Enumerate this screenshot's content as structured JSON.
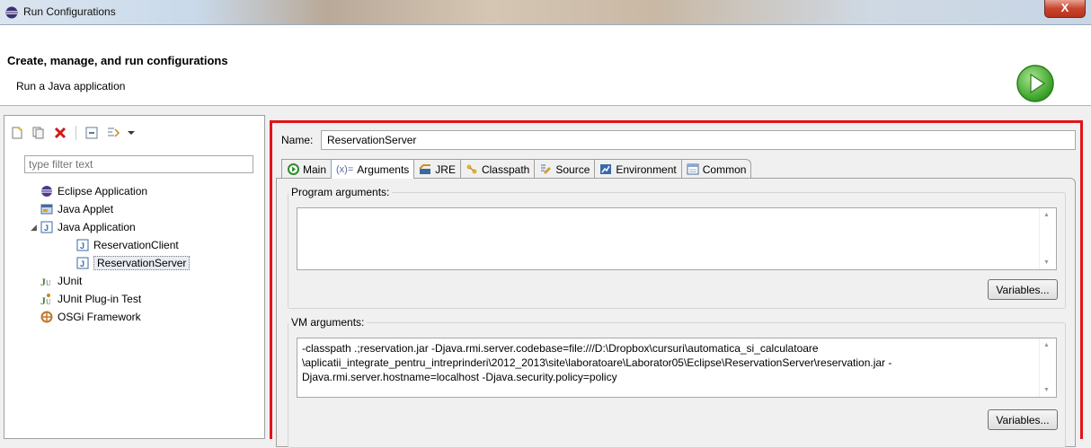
{
  "window": {
    "title": "Run Configurations",
    "close_glyph": "X"
  },
  "banner": {
    "heading": "Create, manage, and run configurations",
    "subheading": "Run a Java application",
    "icon": "run-icon"
  },
  "left": {
    "toolbar_icons": [
      "new-configuration-icon",
      "duplicate-icon",
      "delete-icon",
      "collapse-all-icon",
      "filter-icon",
      "dropdown-arrow-icon"
    ],
    "filter_placeholder": "type filter text",
    "tree": [
      {
        "label": "Eclipse Application",
        "icon": "eclipse-icon"
      },
      {
        "label": "Java Applet",
        "icon": "java-applet-icon"
      },
      {
        "label": "Java Application",
        "icon": "java-application-icon",
        "expanded": true
      },
      {
        "label": "ReservationClient",
        "icon": "java-class-icon"
      },
      {
        "label": "ReservationServer",
        "icon": "java-class-icon",
        "selected": true
      },
      {
        "label": "JUnit",
        "icon": "junit-icon"
      },
      {
        "label": "JUnit Plug-in Test",
        "icon": "junit-plugin-icon"
      },
      {
        "label": "OSGi Framework",
        "icon": "osgi-icon"
      }
    ]
  },
  "right": {
    "name_label": "Name:",
    "name_value": "ReservationServer",
    "tabs": [
      {
        "label": "Main",
        "icon": "main-tab-icon"
      },
      {
        "label": "Arguments",
        "icon": "arguments-icon",
        "prefix": "(x)=",
        "active": true
      },
      {
        "label": "JRE",
        "icon": "jre-icon"
      },
      {
        "label": "Classpath",
        "icon": "classpath-icon"
      },
      {
        "label": "Source",
        "icon": "source-icon"
      },
      {
        "label": "Environment",
        "icon": "environment-icon"
      },
      {
        "label": "Common",
        "icon": "common-icon"
      }
    ],
    "program_args": {
      "label": "Program arguments:",
      "value": "",
      "variables_button": "Variables..."
    },
    "vm_args": {
      "label": "VM arguments:",
      "lines": [
        "-classpath .;reservation.jar -Djava.rmi.server.codebase=file:///D:\\Dropbox\\cursuri\\automatica_si_calculatoare",
        "\\aplicatii_integrate_pentru_intreprinderi\\2012_2013\\site\\laboratoare\\Laborator05\\Eclipse\\ReservationServer\\reservation.jar -",
        "Djava.rmi.server.hostname=localhost -Djava.security.policy=policy"
      ],
      "variables_button": "Variables..."
    }
  },
  "colors": {
    "highlight_border": "#e0141c",
    "run_green": "#3fae2a"
  }
}
